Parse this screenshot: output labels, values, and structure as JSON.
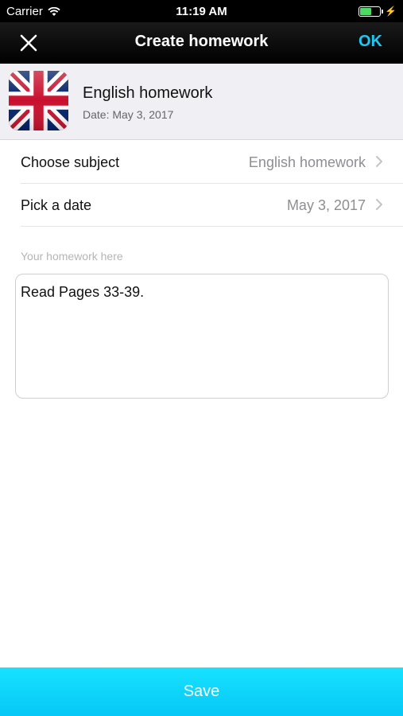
{
  "status_bar": {
    "carrier": "Carrier",
    "time": "11:19 AM",
    "battery_level": 0.6,
    "battery_color": "#4cd964"
  },
  "nav": {
    "title": "Create homework",
    "ok_label": "OK",
    "ok_color": "#1ec8f5",
    "close_icon": "close-icon"
  },
  "header": {
    "icon": "uk-flag-icon",
    "title": "English homework",
    "date": "Date: May 3, 2017"
  },
  "rows": [
    {
      "label": "Choose subject",
      "value": "English homework",
      "icon": "chevron-right-icon"
    },
    {
      "label": "Pick a date",
      "value": "May 3, 2017",
      "icon": "chevron-right-icon"
    }
  ],
  "homework": {
    "hint": "Your homework here",
    "text": "Read Pages 33-39."
  },
  "save": {
    "label": "Save",
    "color": "#06c7f6"
  }
}
